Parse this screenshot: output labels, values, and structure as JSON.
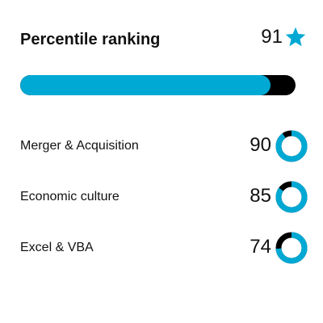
{
  "header": {
    "title": "Percentile ranking",
    "overall_value": "91",
    "overall_icon": "star-icon"
  },
  "progress": {
    "value_percent": 91
  },
  "skills": [
    {
      "label": "Merger & Acquisition",
      "value": "90",
      "percent": 90
    },
    {
      "label": "Economic culture",
      "value": "85",
      "percent": 85
    },
    {
      "label": "Excel & VBA",
      "value": "74",
      "percent": 74
    }
  ],
  "colors": {
    "accent": "#00a9d4",
    "track": "#000000",
    "text": "#111111"
  }
}
